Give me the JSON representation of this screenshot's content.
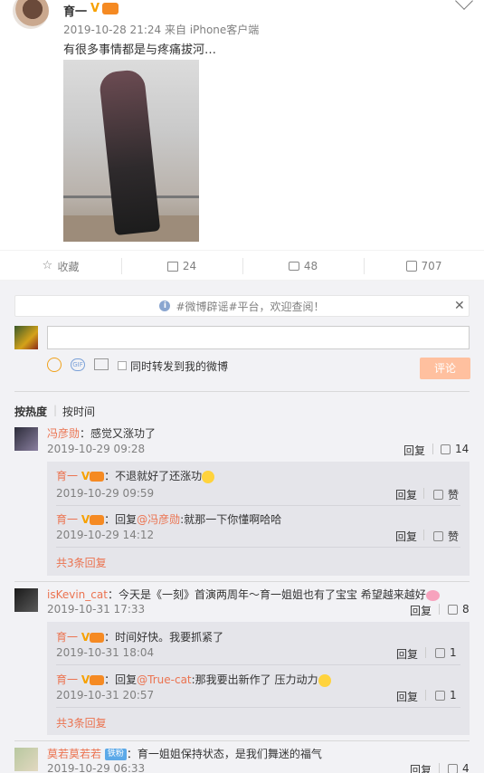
{
  "post": {
    "author": "育一",
    "meta": "2019-10-28 21:24 来自 iPhone客户端",
    "text": "有很多事情都是与疼痛拔河…"
  },
  "actions": {
    "favorite": "收藏",
    "forward": "24",
    "comment": "48",
    "like": "707"
  },
  "notice": "#微博辟谣#平台，欢迎查阅！",
  "composer": {
    "repost_label": "同时转发到我的微博",
    "submit": "评论"
  },
  "sort": {
    "hot": "按热度",
    "time": "按时间"
  },
  "comments": [
    {
      "name": "冯彦勋",
      "text": "：感觉又涨功了",
      "time": "2019-10-29 09:28",
      "reply_btn": "回复",
      "likes": "14",
      "replies": [
        {
          "name": "育一",
          "text": "：不退就好了还涨功",
          "time": "2019-10-29 09:59",
          "reply_btn": "回复",
          "like_label": "赞"
        },
        {
          "name": "育一",
          "prefix": "：回复",
          "mention": "@冯彦勋",
          "text": ":就那一下你懂啊哈哈",
          "time": "2019-10-29 14:12",
          "reply_btn": "回复",
          "like_label": "赞"
        }
      ],
      "more": "共3条回复"
    },
    {
      "name": "isKevin_cat",
      "text": "：今天是《一刻》首演两周年～育一姐姐也有了宝宝 希望越来越好",
      "time": "2019-10-31 17:33",
      "reply_btn": "回复",
      "likes": "8",
      "replies": [
        {
          "name": "育一",
          "text": "：时间好快。我要抓紧了",
          "time": "2019-10-31 18:04",
          "reply_btn": "回复",
          "like_label": "1"
        },
        {
          "name": "育一",
          "prefix": "：回复",
          "mention": "@True-cat",
          "text": ":那我要出新作了 压力动力",
          "time": "2019-10-31 20:57",
          "reply_btn": "回复",
          "like_label": "1"
        }
      ],
      "more": "共3条回复"
    },
    {
      "name": "莫若莫若若",
      "badge": "铁粉",
      "text": "：育一姐姐保持状态，是我们舞迷的福气",
      "time": "2019-10-29 06:33",
      "reply_btn": "回复",
      "likes": "4"
    }
  ]
}
